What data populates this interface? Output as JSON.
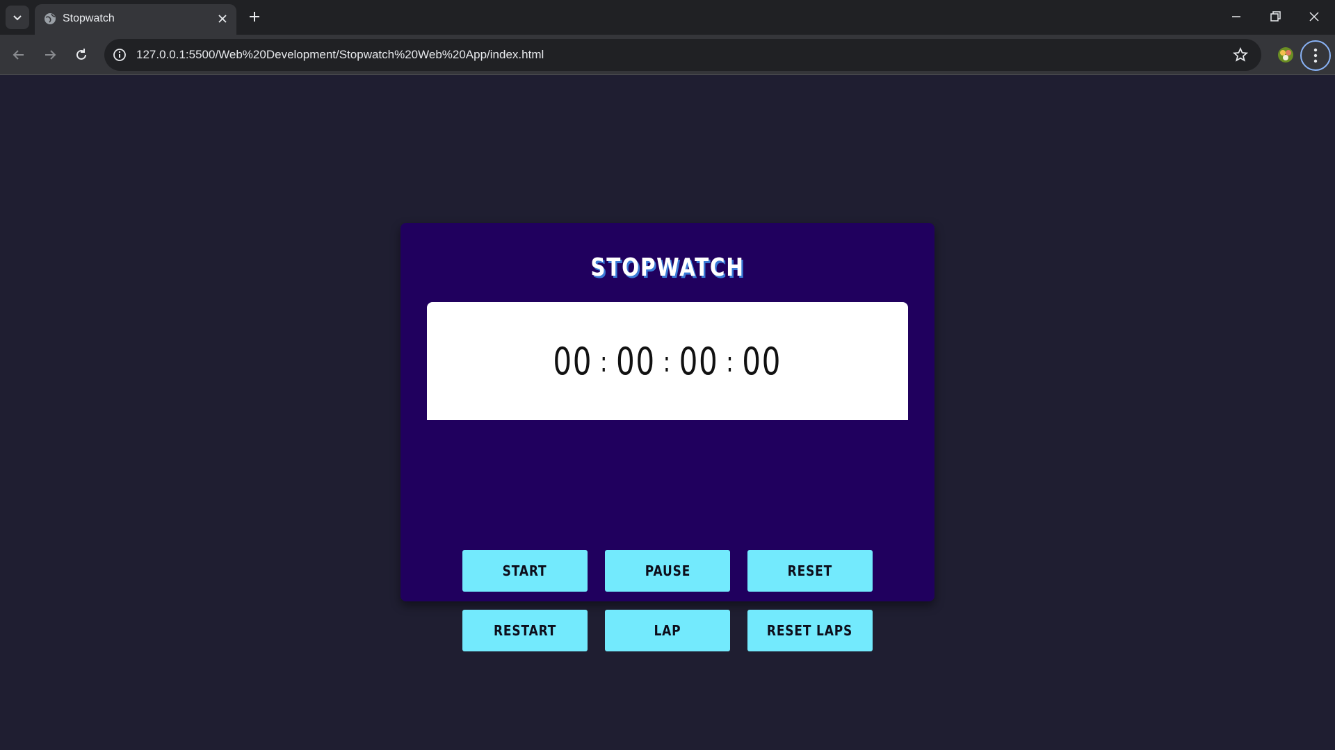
{
  "browser": {
    "tab_title": "Stopwatch",
    "url": "127.0.0.1:5500/Web%20Development/Stopwatch%20Web%20App/index.html"
  },
  "app": {
    "title": "STOPWATCH",
    "time": {
      "hours": "00",
      "minutes": "00",
      "seconds": "00",
      "centiseconds": "00",
      "separator": ":"
    },
    "buttons": {
      "start": "START",
      "pause": "PAUSE",
      "reset": "RESET",
      "restart": "RESTART",
      "lap": "LAP",
      "reset_laps": "RESET LAPS"
    }
  },
  "colors": {
    "page_bg": "#1f1e31",
    "card_bg": "#20005e",
    "button_bg": "#73eafd",
    "display_bg": "#ffffff"
  },
  "icons": {
    "tab_list": "chevron-down-icon",
    "favicon": "globe-icon",
    "tab_close": "close-icon",
    "new_tab": "plus-icon",
    "back": "arrow-left-icon",
    "forward": "arrow-right-icon",
    "reload": "reload-icon",
    "site_info": "info-icon",
    "bookmark": "star-icon",
    "extension": "extension-icon",
    "menu": "kebab-menu-icon"
  }
}
